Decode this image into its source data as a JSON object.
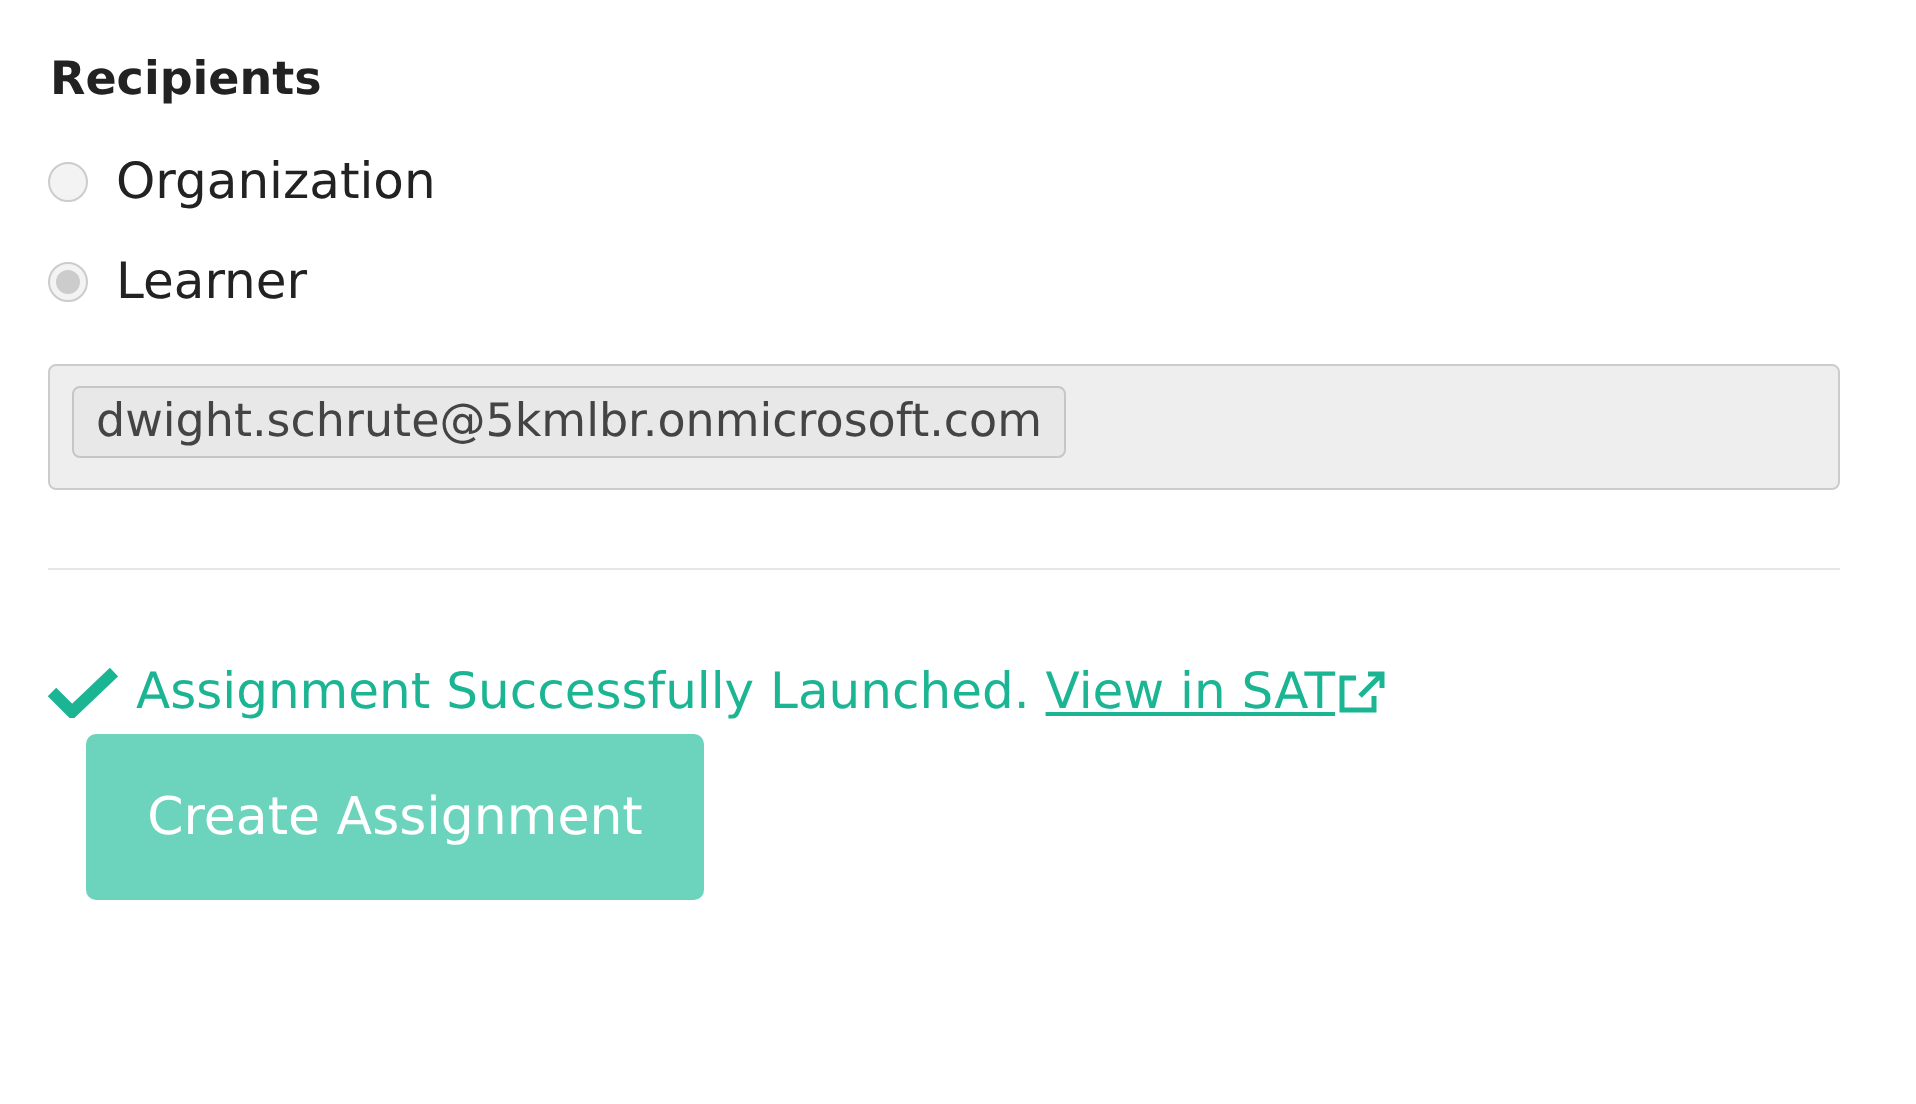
{
  "recipients": {
    "heading": "Recipients",
    "options": [
      {
        "label": "Organization",
        "selected": false,
        "disabled": true
      },
      {
        "label": "Learner",
        "selected": true,
        "disabled": true
      }
    ],
    "field": {
      "disabled": true,
      "tags": [
        "dwight.schrute@5kmlbr.onmicrosoft.com"
      ]
    }
  },
  "status": {
    "message": "Assignment Successfully Launched.",
    "link": "View in SAT"
  },
  "button": {
    "label": "Create Assignment",
    "disabled": true
  }
}
